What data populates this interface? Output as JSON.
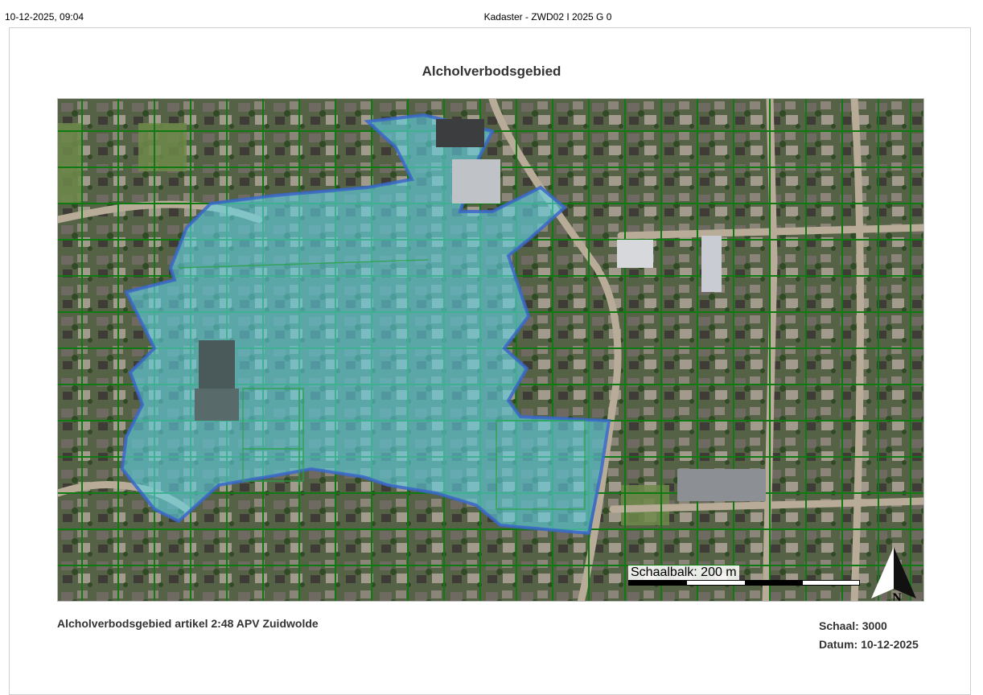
{
  "header": {
    "datetime": "10-12-2025, 09:04",
    "document_title": "Kadaster - ZWD02 I 2025 G 0"
  },
  "map": {
    "title": "Alcholverbodsgebied",
    "description": "Alcholverbodsgebied artikel 2:48 APV Zuidwolde",
    "scale_label": "Schaal: 3000",
    "date_label": "Datum: 10-12-2025",
    "scalebar_label": "Schaalbalk: 200 m",
    "north_label": "N",
    "colors": {
      "zone_fill": "#5fd3e6",
      "zone_outline": "#3a67c9",
      "parcel_lines": "#0f7a12"
    }
  }
}
